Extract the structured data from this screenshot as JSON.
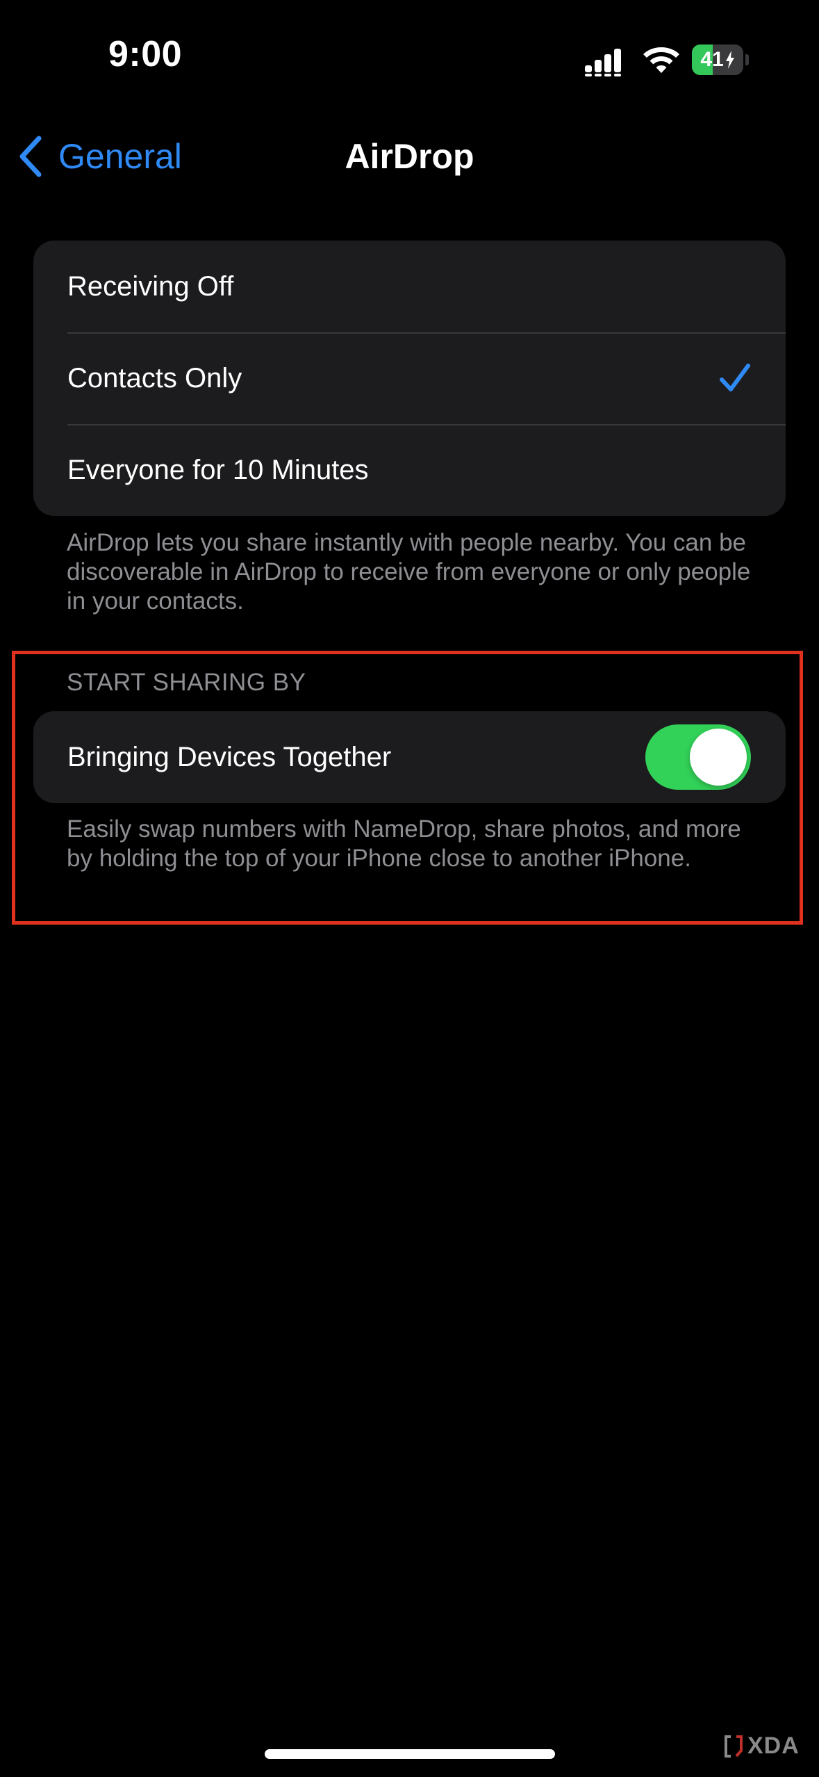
{
  "status_bar": {
    "time": "9:00",
    "battery_level": "41",
    "battery_fraction": 0.41,
    "icons": [
      "cellular-signal-icon",
      "wifi-icon",
      "battery-charging-icon"
    ]
  },
  "nav": {
    "back_label": "General",
    "title": "AirDrop"
  },
  "receiving": {
    "options": [
      {
        "label": "Receiving Off",
        "selected": false
      },
      {
        "label": "Contacts Only",
        "selected": true
      },
      {
        "label": "Everyone for 10 Minutes",
        "selected": false
      }
    ],
    "footer": "AirDrop lets you share instantly with people nearby. You can be discoverable in AirDrop to receive from everyone or only people in your contacts."
  },
  "start_sharing": {
    "header": "START SHARING BY",
    "toggle_label": "Bringing Devices Together",
    "toggle_on": true,
    "footer": "Easily swap numbers with NameDrop, share photos, and more by holding the top of your iPhone close to another iPhone."
  },
  "watermark": "XDA",
  "colors": {
    "accent": "#2f8af5",
    "toggle_on": "#32d158",
    "highlight": "#e0301e",
    "battery_fill": "#34c759"
  }
}
